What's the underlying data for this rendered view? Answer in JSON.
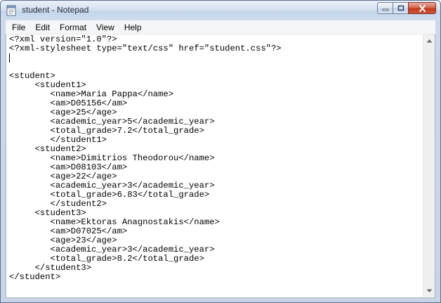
{
  "window": {
    "title": "student - Notepad"
  },
  "menu": {
    "items": [
      {
        "label": "File"
      },
      {
        "label": "Edit"
      },
      {
        "label": "Format"
      },
      {
        "label": "View"
      },
      {
        "label": "Help"
      }
    ]
  },
  "editor": {
    "lines": [
      "<?xml version=\"1.0\"?>",
      "<?xml-stylesheet type=\"text/css\" href=\"student.css\"?>",
      "",
      "",
      "<student>",
      "     <student1>",
      "        <name>Maria Pappa</name>",
      "        <am>D05156</am>",
      "        <age>25</age>",
      "        <academic_year>5</academic_year>",
      "        <total_grade>7.2</total_grade>",
      "        </student1>",
      "     <student2>",
      "        <name>Dimitrios Theodorou</name>",
      "        <am>D08103</am>",
      "        <age>22</age>",
      "        <academic_year>3</academic_year>",
      "        <total_grade>6.83</total_grade>",
      "        </student2>",
      "     <student3>",
      "        <name>Ektoras Anagnostakis</name>",
      "        <am>D07025</am>",
      "        <age>23</age>",
      "        <academic_year>3</academic_year>",
      "        <total_grade>8.2</total_grade>",
      "     </student3>",
      "</student>"
    ]
  },
  "icons": {
    "app": "notepad-icon",
    "minimize": "minimize-icon",
    "maximize": "maximize-icon",
    "close": "close-icon",
    "scroll_up": "scroll-up-arrow-icon",
    "scroll_down": "scroll-down-arrow-icon"
  },
  "colors": {
    "close_button": "#c2391c",
    "frame": "#c7d5e7",
    "text": "#000000"
  }
}
